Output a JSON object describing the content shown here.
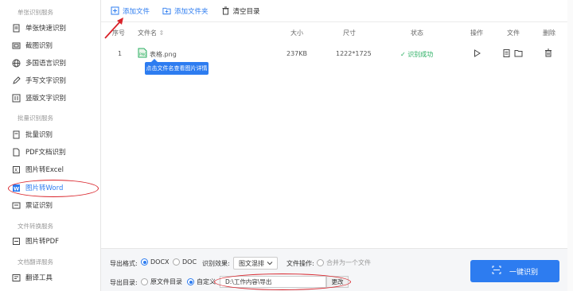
{
  "sidebar": {
    "section_single": "单张识别服务",
    "section_batch": "批量识别服务",
    "section_convert": "文件转换服务",
    "section_translate": "文档翻译服务",
    "items": [
      {
        "label": "单张快速识别",
        "icon": "document-icon"
      },
      {
        "label": "截图识别",
        "icon": "screenshot-icon"
      },
      {
        "label": "多国语言识别",
        "icon": "globe-icon"
      },
      {
        "label": "手写文字识别",
        "icon": "pen-icon"
      },
      {
        "label": "竖版文字识别",
        "icon": "vertical-text-icon"
      },
      {
        "label": "批量识别",
        "icon": "batch-icon"
      },
      {
        "label": "PDF文档识别",
        "icon": "pdf-icon"
      },
      {
        "label": "图片转Excel",
        "icon": "excel-icon"
      },
      {
        "label": "图片转Word",
        "icon": "word-icon"
      },
      {
        "label": "票证识别",
        "icon": "ticket-icon"
      },
      {
        "label": "图片转PDF",
        "icon": "pdf-file-icon"
      },
      {
        "label": "翻译工具",
        "icon": "translate-icon"
      }
    ]
  },
  "toolbar": {
    "add_file": "添加文件",
    "add_folder": "添加文件夹",
    "clear": "清空目录"
  },
  "table": {
    "headers": {
      "index": "序号",
      "filename": "文件名",
      "size": "大小",
      "dimension": "尺寸",
      "status": "状态",
      "action": "操作",
      "file": "文件",
      "delete": "删除"
    },
    "rows": [
      {
        "index": "1",
        "filename": "表格.png",
        "size": "237KB",
        "dimension": "1222*1725",
        "status": "识别成功"
      }
    ],
    "tooltip": "点击文件名查看图片详情"
  },
  "bottom": {
    "format_label": "导出格式:",
    "format_docx": "DOCX",
    "format_doc": "DOC",
    "effect_label": "识别效果:",
    "effect_value": "图文混排",
    "file_op_label": "文件操作:",
    "merge_label": "合并为一个文件",
    "dir_label": "导出目录:",
    "dir_original": "原文件目录",
    "dir_custom": "自定义",
    "path": "D:\\工作内容\\导出",
    "change": "更改",
    "recognize": "一键识别"
  },
  "colors": {
    "accent": "#2d7cf0",
    "success": "#27ae60",
    "highlight": "#d9232a"
  }
}
